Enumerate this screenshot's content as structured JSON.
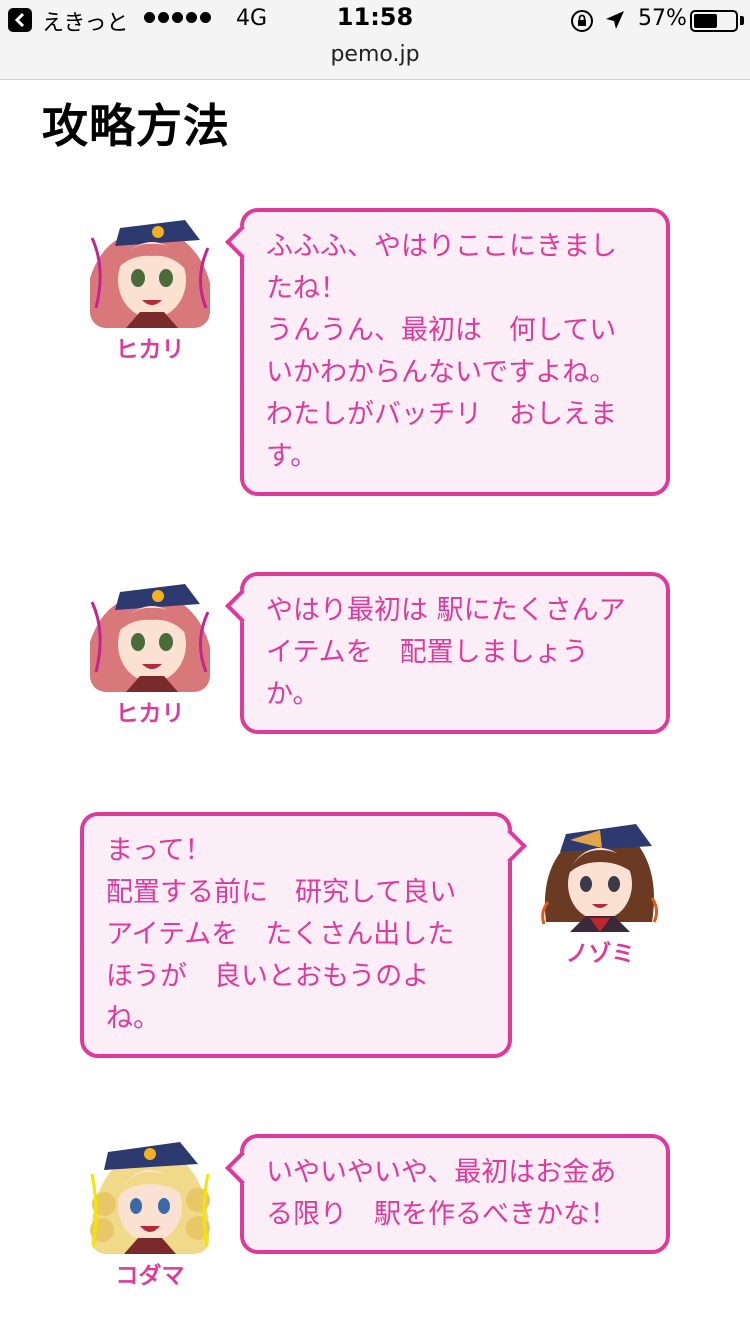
{
  "status_bar": {
    "back_app": "えきっと",
    "network": "4G",
    "time": "11:58",
    "battery": "57%",
    "battery_level": 0.57,
    "url": "pemo.jp"
  },
  "page": {
    "title": "攻略方法"
  },
  "dialogues": [
    {
      "speaker": "ヒカリ",
      "side": "left",
      "lines": [
        "ふふふ、やはりここにきまし",
        "たね！",
        "うんうん、最初は　何してい",
        "いかわからんないですよね。",
        "わたしがバッチリ　おしえま",
        "す。"
      ]
    },
    {
      "speaker": "ヒカリ",
      "side": "left",
      "lines": [
        "やはり最初は 駅にたくさんア",
        "イテムを　配置しましょう",
        "か。"
      ]
    },
    {
      "speaker": "ノゾミ",
      "side": "right",
      "lines": [
        "まって！",
        "配置する前に　研究して良い",
        "アイテムを　たくさん出した",
        "ほうが　良いとおもうのよ",
        "ね。"
      ]
    },
    {
      "speaker": "コダマ",
      "side": "left",
      "lines": [
        "いやいやいや、最初はお金あ",
        "る限り　駅を作るべきかな！"
      ]
    }
  ],
  "colors": {
    "accent": "#e0399c",
    "bubble_bg": "#fbeef6"
  }
}
